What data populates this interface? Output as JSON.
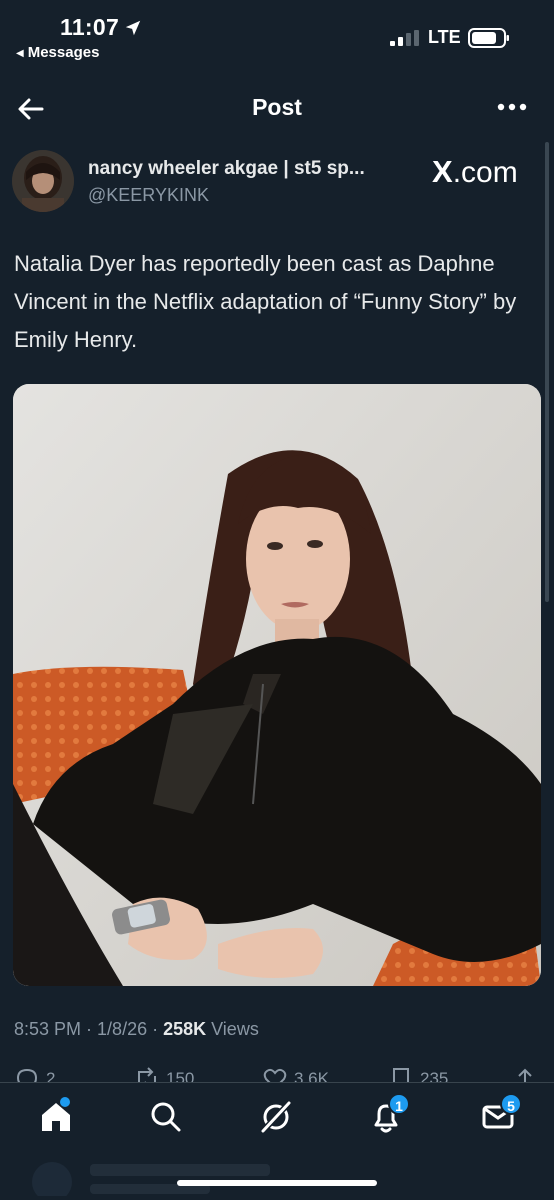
{
  "status_bar": {
    "time": "11:07",
    "back_app": "Messages",
    "network": "LTE"
  },
  "header": {
    "title": "Post"
  },
  "author": {
    "name": "nancy wheeler akgae | st5 sp...",
    "handle": "@KEERYKINK"
  },
  "source": {
    "prefix": "X",
    "suffix": ".com"
  },
  "tweet": {
    "text": "Natalia Dyer has reportedly been cast as Daphne Vincent in the Netflix adaptation of “Funny Story” by Emily Henry."
  },
  "meta": {
    "time": "8:53 PM",
    "sep1": " · ",
    "date": "1/8/26",
    "sep2": " · ",
    "views_count": "258K",
    "views_label": " Views"
  },
  "actions": {
    "replies": "2",
    "reposts": "150",
    "likes": "3.6K",
    "bookmarks": "235"
  },
  "tabbar": {
    "notifications_badge": "1",
    "messages_badge": "5"
  },
  "colors": {
    "background": "#15202b",
    "accent": "#1d9bf0",
    "secondary_text": "#8b98a5"
  }
}
